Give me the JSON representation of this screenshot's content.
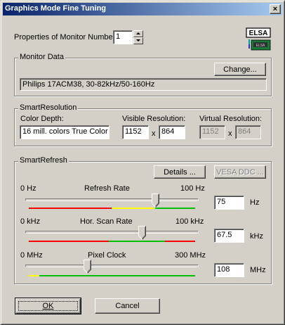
{
  "window": {
    "title": "Graphics Mode Fine Tuning",
    "close_glyph": "×"
  },
  "monitor": {
    "label": "Properties of Monitor Number:",
    "value": "1"
  },
  "logo": {
    "text": "ELSA",
    "chip_text": "ELSA"
  },
  "monitor_data": {
    "group_title": "Monitor Data",
    "change_button": "Change...",
    "description": "Philips 17ACM38, 30-82kHz/50-160Hz"
  },
  "smart_resolution": {
    "group_title": "SmartResolution",
    "color_depth_label": "Color Depth:",
    "color_depth_value": "16 mill. colors True Color",
    "visible_label": "Visible Resolution:",
    "visible_w": "1152",
    "visible_h": "864",
    "virtual_label": "Virtual Resolution:",
    "virtual_w": "1152",
    "virtual_h": "864",
    "x_sep": "x"
  },
  "smart_refresh": {
    "group_title": "SmartRefresh",
    "details_button": "Details ...",
    "vesa_button": "VESA DDC ...",
    "refresh": {
      "min": "0 Hz",
      "title": "Refresh Rate",
      "max": "100 Hz",
      "value": "75",
      "unit": "Hz",
      "level": 0.75
    },
    "hscan": {
      "min": "0 kHz",
      "title": "Hor. Scan Rate",
      "max": "100 kHz",
      "value": "67.5",
      "unit": "kHz",
      "level": 0.675
    },
    "pixel": {
      "min": "0 MHz",
      "title": "Pixel Clock",
      "max": "300 MHz",
      "value": "108",
      "unit": "MHz",
      "level": 0.36
    }
  },
  "buttons": {
    "ok": "OK",
    "cancel": "Cancel"
  },
  "colors": {
    "title_start": "#0a246a",
    "title_end": "#a6caf0",
    "red": "#ff0000",
    "yellow": "#ffff00",
    "green": "#00c000"
  }
}
